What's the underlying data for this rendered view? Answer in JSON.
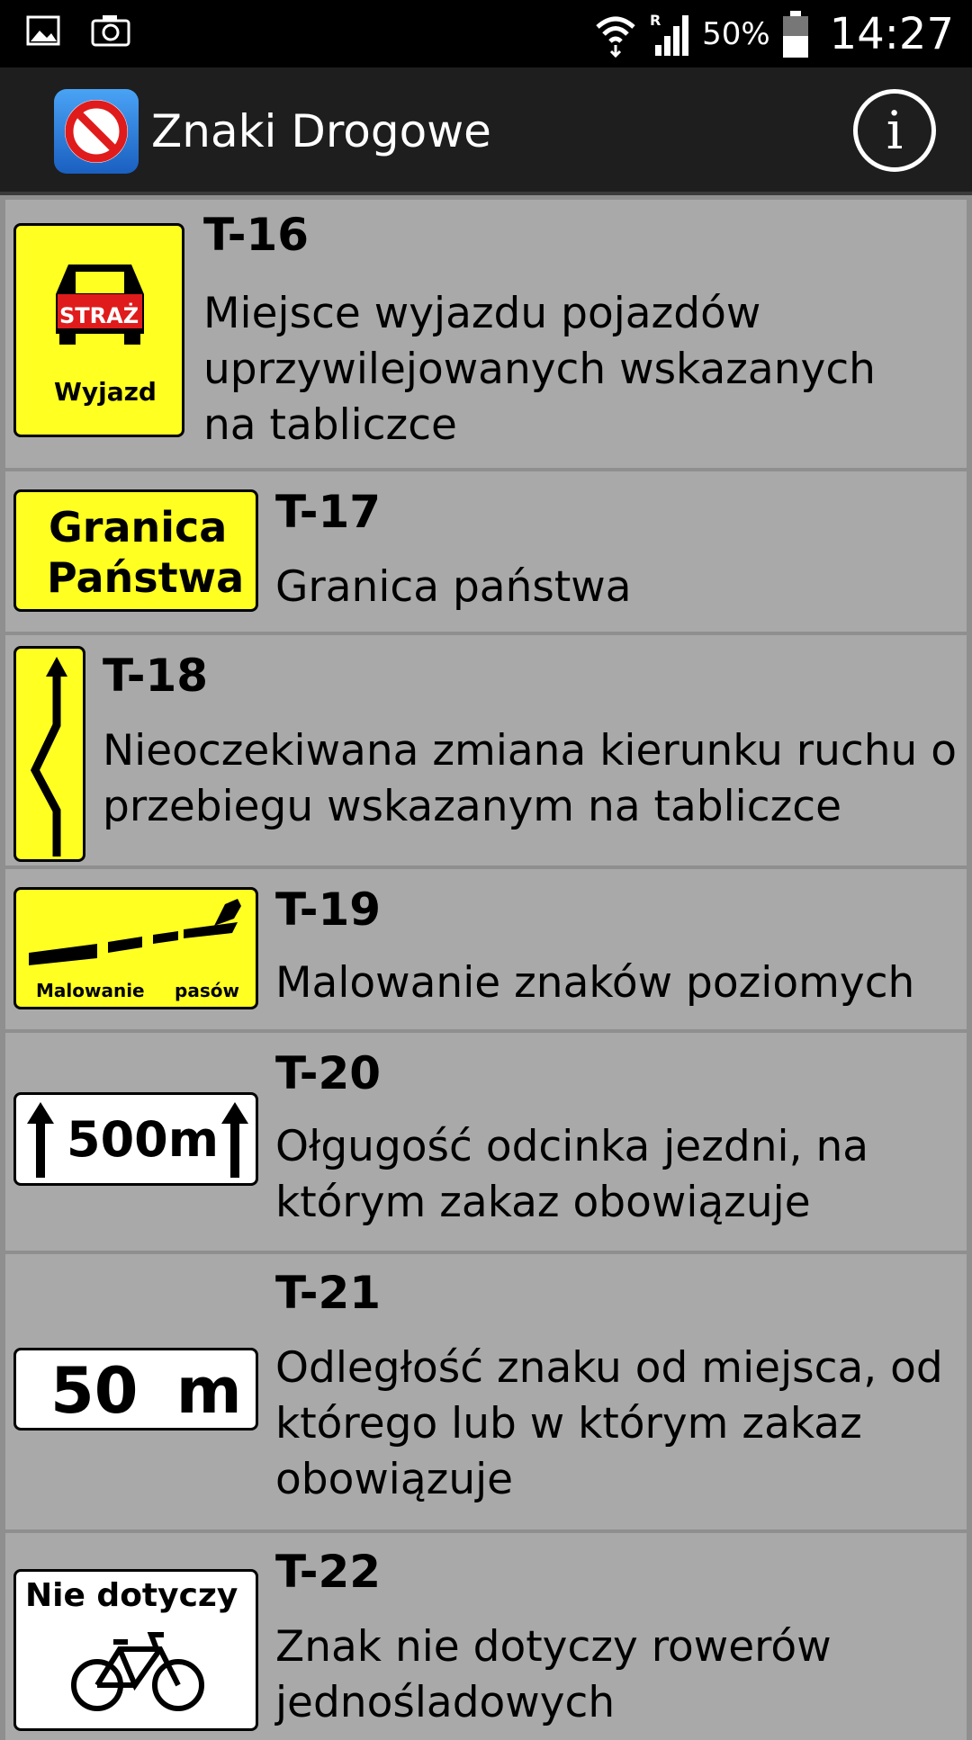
{
  "status_bar": {
    "battery_percent": "50%",
    "time": "14:27",
    "icons": [
      "gallery-icon",
      "camera-icon",
      "wifi-icon",
      "signal-icon",
      "battery-icon"
    ]
  },
  "action_bar": {
    "title": "Znaki Drogowe",
    "info_label": "i"
  },
  "signs": [
    {
      "code": "T-16",
      "description": "Miejsce wyjazdu pojazdów uprzywilejowanych wskazanych na tabliczce",
      "sign_texts": [
        "STRAŻ",
        "Wyjazd"
      ]
    },
    {
      "code": "T-17",
      "description": "Granica państwa",
      "sign_texts": [
        "Granica",
        "Państwa"
      ]
    },
    {
      "code": "T-18",
      "description": "Nieoczekiwana zmiana kierunku ruchu o przebiegu wskazanym na tabliczce",
      "sign_texts": []
    },
    {
      "code": "T-19",
      "description": "Malowanie znaków poziomych",
      "sign_texts": [
        "Malowanie",
        "pasów"
      ]
    },
    {
      "code": "T-20",
      "description": "Ołgugość odcinka jezdni, na którym zakaz obowiązuje",
      "sign_texts": [
        "500m"
      ]
    },
    {
      "code": "T-21",
      "description": "Odległość znaku od miejsca, od którego lub w którym zakaz obowiązuje",
      "sign_texts": [
        "50 m"
      ]
    },
    {
      "code": "T-22",
      "description": "Znak nie dotyczy rowerów jednośladowych",
      "sign_texts": [
        "Nie dotyczy"
      ]
    }
  ],
  "colors": {
    "list_background": "#a9a9a9",
    "sign_yellow": "#ffff22",
    "action_bar": "#1e1e1e",
    "status_bar": "#000000"
  }
}
